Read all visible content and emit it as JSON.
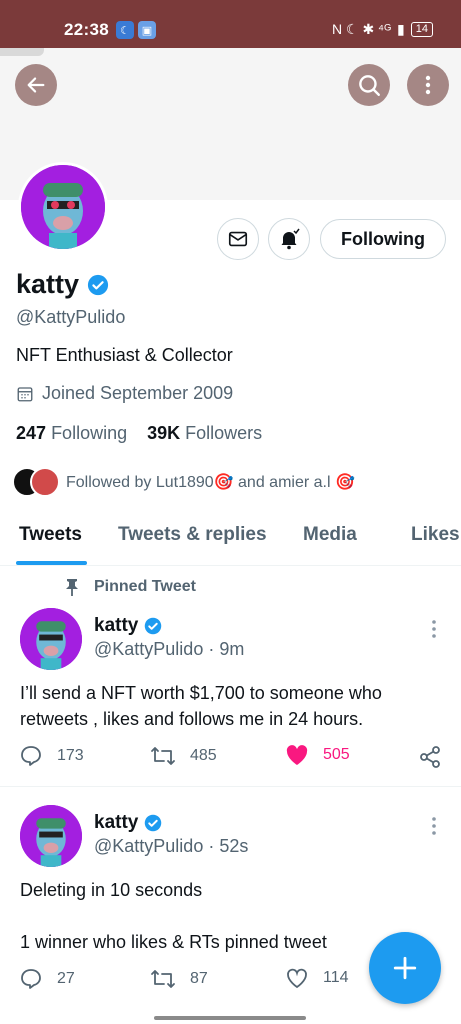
{
  "status_bar": {
    "time": "22:38",
    "right_icons": "N ☾ ✱ ⁴ᴳ",
    "battery": "14"
  },
  "profile": {
    "name": "katty",
    "handle": "@KattyPulido",
    "bio": "NFT Enthusiast & Collector",
    "joined": "Joined September 2009",
    "following_count": "247",
    "following_label": "Following",
    "followers_count": "39K",
    "followers_label": "Followers",
    "followed_by": "Followed by Lut1890🎯 and amier a.l 🎯",
    "follow_button_label": "Following",
    "accent_color": "#1d9bf0",
    "avatar_bg": "#a31fe0"
  },
  "tabs": [
    {
      "label": "Tweets",
      "active": true
    },
    {
      "label": "Tweets & replies",
      "active": false
    },
    {
      "label": "Media",
      "active": false
    },
    {
      "label": "Likes",
      "active": false
    }
  ],
  "tweets": [
    {
      "pinned_label": "Pinned Tweet",
      "name": "katty",
      "handle_time": "@KattyPulido · 9m",
      "text_line1": "I’ll send a NFT worth $1,700 to someone who",
      "text_line2": "retweets , likes and follows me in 24 hours.",
      "replies": "173",
      "retweets": "485",
      "likes": "505",
      "liked": true
    },
    {
      "name": "katty",
      "handle_time": "@KattyPulido · 52s",
      "text_line1": "Deleting in 10 seconds",
      "text_line2": "1 winner who likes & RTs pinned tweet",
      "replies": "27",
      "retweets": "87",
      "likes": "114",
      "liked": false
    }
  ],
  "icons": {
    "back": "back-arrow-icon",
    "search": "search-icon",
    "more": "more-vertical-icon",
    "message": "mail-icon",
    "notify": "bell-icon",
    "calendar": "calendar-icon",
    "pin": "pin-icon",
    "reply": "reply-icon",
    "retweet": "retweet-icon",
    "like": "heart-icon",
    "share": "share-icon",
    "compose": "plus-icon"
  }
}
